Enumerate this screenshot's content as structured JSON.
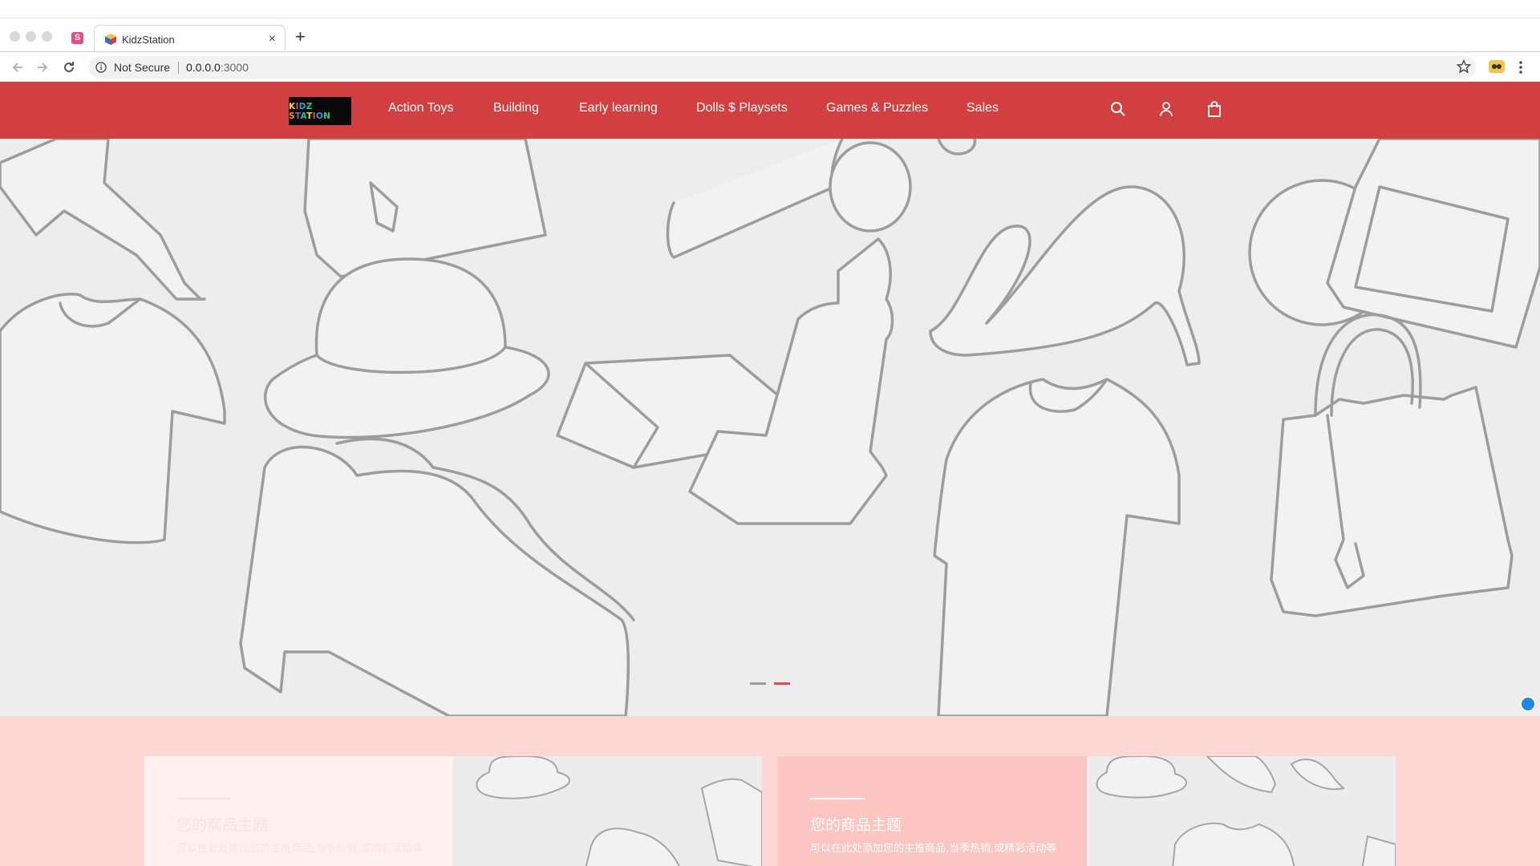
{
  "browser": {
    "tab_title": "KidzStation",
    "pinned_favicon_letter": "S",
    "security_label": "Not Secure",
    "url_host": "0.0.0.0",
    "url_port": ":3000",
    "new_tab_symbol": "+",
    "close_symbol": "×"
  },
  "site": {
    "logo_text": "KIDZ STATION",
    "nav": [
      {
        "label": "Action Toys"
      },
      {
        "label": "Building"
      },
      {
        "label": "Early learning"
      },
      {
        "label": "Dolls $ Playsets"
      },
      {
        "label": "Games & Puzzles"
      },
      {
        "label": "Sales"
      }
    ],
    "icons": [
      "search-icon",
      "user-icon",
      "shopping-bag-icon"
    ]
  },
  "hero": {
    "slide_count": 2,
    "active_slide": 2
  },
  "promo": {
    "cards": [
      {
        "title": "您的商品主题",
        "description": "可以在此处添加您的主推商品,当季热销,或精彩活动等"
      },
      {
        "title": "您的商品主题",
        "description": "可以在此处添加您的主推商品,当季热销,或精彩活动等"
      }
    ]
  },
  "colors": {
    "brand_red": "#d23f41",
    "hero_bg": "#ededed",
    "promo_bg": "#fdd7d4",
    "card_light": "#fff1f0",
    "card_pink": "#fcc5c1",
    "dot_inactive": "#9a9a9a",
    "dot_active": "#e84b4d"
  }
}
